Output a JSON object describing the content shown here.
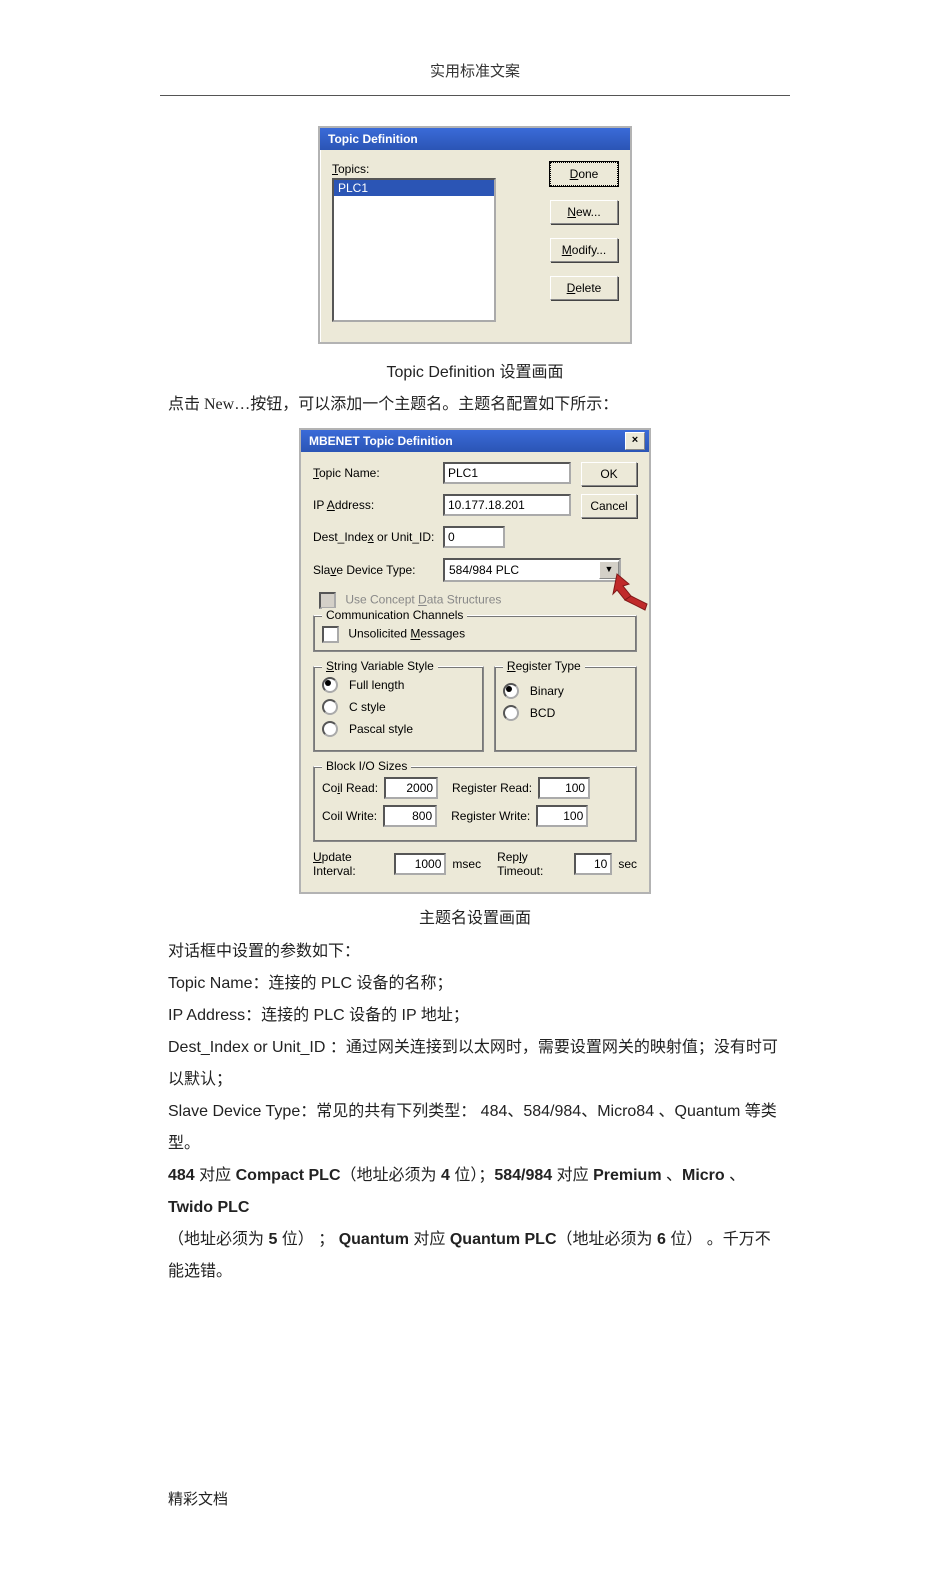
{
  "header": "实用标准文案",
  "dialog1": {
    "title": "Topic Definition",
    "topics_label": "Topics:",
    "topics_underline": "T",
    "selected_topic": "PLC1",
    "buttons": {
      "done": "Done",
      "done_u": "D",
      "new": "New...",
      "new_u": "N",
      "modify": "Modify...",
      "modify_u": "M",
      "delete": "Delete",
      "delete_u": "D"
    }
  },
  "caption1_a": "Topic Definition",
  "caption1_b": "  设置画面",
  "line_new": "点击 New…按钮，可以添加一个主题名。主题名配置如下所示：",
  "dialog2": {
    "title": "MBENET Topic Definition",
    "close": "×",
    "rows": {
      "topic_name_label": "Topic Name:",
      "topic_name_u": "T",
      "topic_name_val": "PLC1",
      "ip_label": "IP Address:",
      "ip_u": "A",
      "ip_val": "10.177.18.201",
      "dest_label": "Dest_Index or Unit_ID:",
      "dest_u": "x",
      "dest_val": "0",
      "slave_label": "Slave Device Type:",
      "slave_u": "v",
      "slave_val": "584/984 PLC"
    },
    "btn_ok": "OK",
    "btn_cancel": "Cancel",
    "concept": "Use Concept Data Structures",
    "concept_u": "D",
    "group_comm": {
      "legend": "Communication Channels",
      "unsolicited": "Unsolicited Messages",
      "unsolicited_u": "M"
    },
    "group_svs": {
      "legend": "String Variable Style",
      "legend_u": "S",
      "full": "Full length",
      "c": "C style",
      "pascal": "Pascal style"
    },
    "group_reg": {
      "legend": "Register Type",
      "legend_u": "R",
      "binary": "Binary",
      "bcd": "BCD"
    },
    "group_bio": {
      "legend": "Block I/O Sizes",
      "coil_read": "Coil Read:",
      "coil_read_u": "i",
      "coil_read_val": "2000",
      "reg_read": "Register Read:",
      "reg_read_val": "100",
      "coil_write": "Coil Write:",
      "coil_write_val": "800",
      "reg_write": "Register Write:",
      "reg_write_val": "100"
    },
    "update_label": "Update Interval:",
    "update_u": "U",
    "update_val": "1000",
    "msec": "msec",
    "reply_label": "Reply Timeout:",
    "reply_u": "l",
    "reply_val": "10",
    "sec": "sec"
  },
  "caption2": "主题名设置画面",
  "paras": {
    "p_intro": "对话框中设置的参数如下：",
    "p_topicname": "Topic Name：连接的  PLC 设备的名称；",
    "p_ip": "IP Address：连接的  PLC 设备的  IP 地址；",
    "p_dest": "Dest_Index or Unit_ID ：通过网关连接到以太网时，需要设置网关的映射值；没有时可以默认；",
    "p_slave": "Slave Device Type：常见的共有下列类型：    484、584/984、Micro84 、Quantum 等类型。",
    "p_bold1_a": "484",
    "p_bold1_b": " 对应 ",
    "p_bold1_c": "Compact PLC",
    "p_bold1_d": "（地址必须为   ",
    "p_bold1_e": "4",
    "p_bold1_f": " 位）；",
    "p_bold1_g": "584/984",
    "p_bold1_h": " 对应 ",
    "p_bold1_i": "Premium",
    "p_bold1_j": " 、",
    "p_bold1_k": "Micro",
    "p_bold1_l": " 、",
    "p_bold1_m": "Twido PLC",
    "p_tail1": "（地址必须为   ",
    "p_tail2": "5",
    "p_tail3": " 位） ；",
    "p_tail4": " Quantum",
    "p_tail5": " 对应 ",
    "p_tail6": "Quantum  PLC",
    "p_tail7": "（地址必须为   ",
    "p_tail8": "6",
    "p_tail9": " 位） 。千万不能选错。"
  },
  "footer": "精彩文档"
}
